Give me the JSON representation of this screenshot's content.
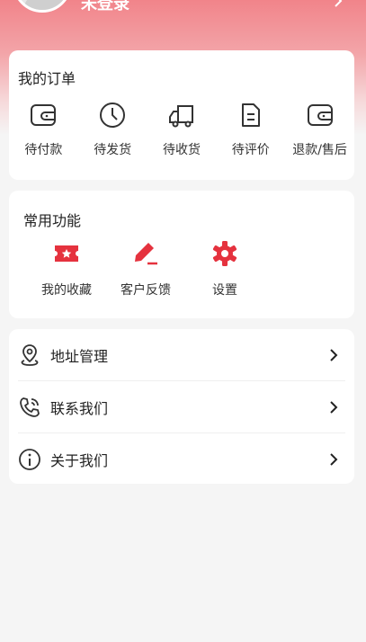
{
  "profile": {
    "username": "未登录"
  },
  "orders": {
    "title": "我的订单",
    "items": [
      {
        "label": "待付款",
        "icon": "wallet-icon"
      },
      {
        "label": "待发货",
        "icon": "clock-icon"
      },
      {
        "label": "待收货",
        "icon": "truck-icon"
      },
      {
        "label": "待评价",
        "icon": "document-icon"
      },
      {
        "label": "退款/售后",
        "icon": "wallet-icon"
      }
    ]
  },
  "functions": {
    "title": "常用功能",
    "accent_color": "#e5323e",
    "items": [
      {
        "label": "我的收藏",
        "icon": "ticket-star-icon"
      },
      {
        "label": "客户反馈",
        "icon": "pencil-icon"
      },
      {
        "label": "设置",
        "icon": "gear-icon"
      }
    ]
  },
  "menu": {
    "items": [
      {
        "label": "地址管理",
        "icon": "location-pin-icon"
      },
      {
        "label": "联系我们",
        "icon": "phone-icon"
      },
      {
        "label": "关于我们",
        "icon": "info-icon"
      }
    ]
  }
}
